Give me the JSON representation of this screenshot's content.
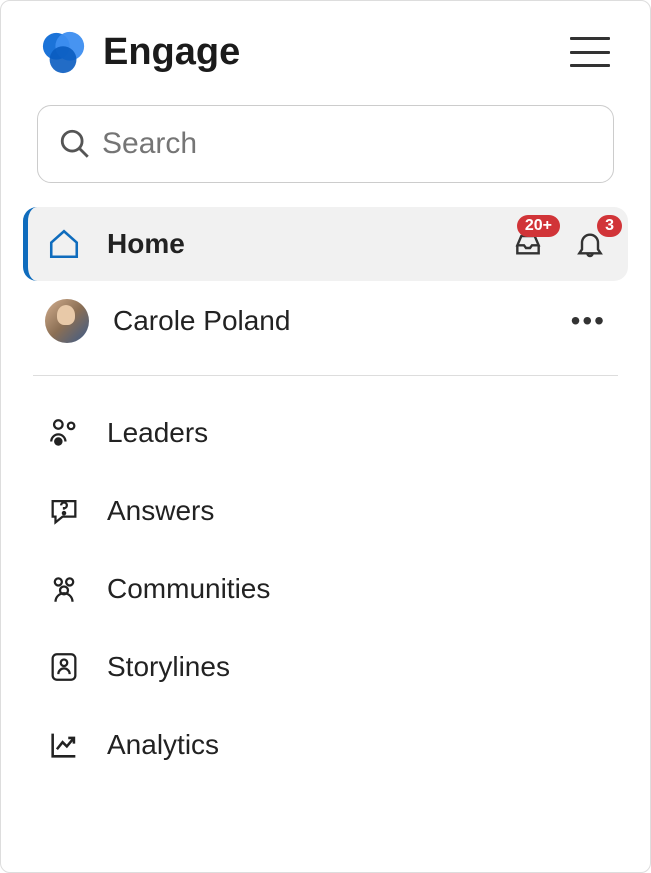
{
  "header": {
    "title": "Engage"
  },
  "search": {
    "placeholder": "Search"
  },
  "nav": {
    "home_label": "Home",
    "inbox_badge": "20+",
    "notif_badge": "3"
  },
  "user": {
    "name": "Carole Poland"
  },
  "menu": {
    "items": [
      {
        "label": "Leaders",
        "icon": "leaders-icon"
      },
      {
        "label": "Answers",
        "icon": "answers-icon"
      },
      {
        "label": "Communities",
        "icon": "communities-icon"
      },
      {
        "label": "Storylines",
        "icon": "storylines-icon"
      },
      {
        "label": "Analytics",
        "icon": "analytics-icon"
      }
    ]
  }
}
